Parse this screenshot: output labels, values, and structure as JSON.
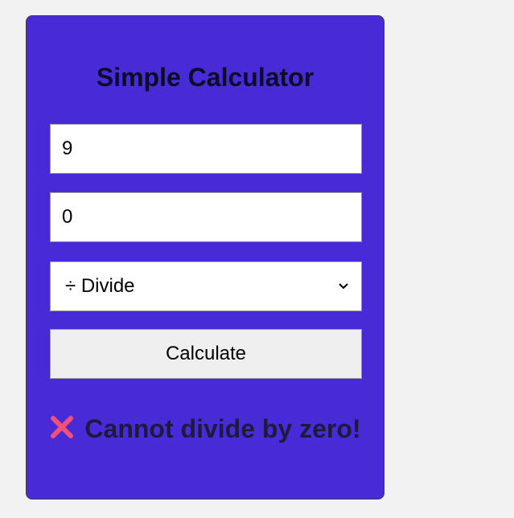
{
  "calculator": {
    "title": "Simple Calculator",
    "first_number": "9",
    "second_number": "0",
    "operation": {
      "selected": "÷ Divide",
      "icon": "chevron-down-icon"
    },
    "calculate_label": "Calculate",
    "result": {
      "icon": "cross-mark-icon",
      "message": "Cannot divide by zero!"
    }
  },
  "colors": {
    "page_background": "#f2f2f2",
    "card_background": "#482bd6",
    "error_icon": "#f0507a"
  }
}
